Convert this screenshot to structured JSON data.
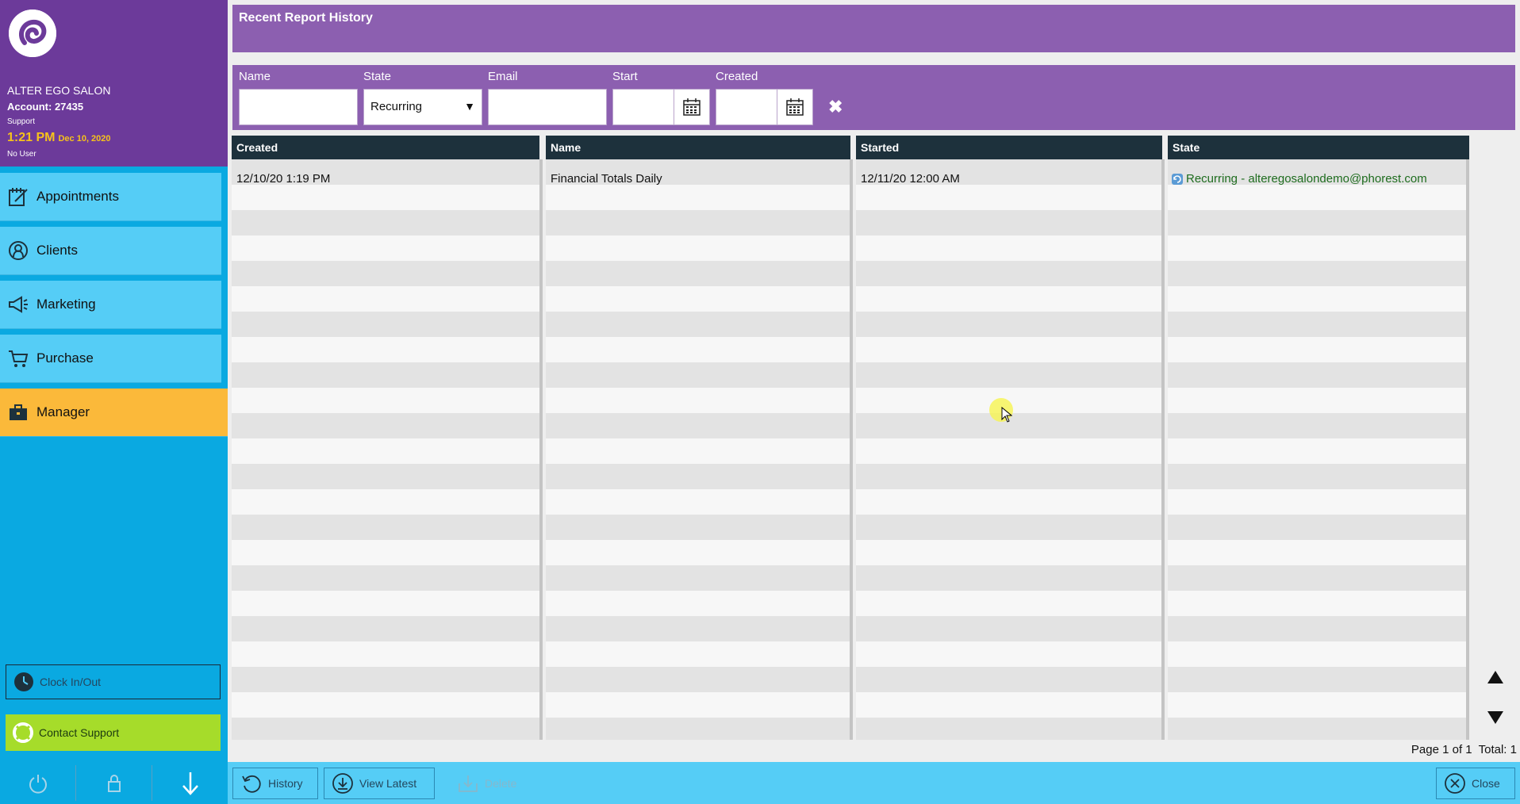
{
  "sidebar": {
    "salon_name": "ALTER EGO SALON",
    "account": "Account: 27435",
    "role": "Support",
    "time": "1:21 PM",
    "date": "Dec 10, 2020",
    "user": "No User",
    "nav": [
      {
        "label": "Appointments",
        "icon": "appointments-icon"
      },
      {
        "label": "Clients",
        "icon": "clients-icon"
      },
      {
        "label": "Marketing",
        "icon": "megaphone-icon"
      },
      {
        "label": "Purchase",
        "icon": "cart-icon"
      },
      {
        "label": "Manager",
        "icon": "briefcase-icon",
        "active": true
      }
    ],
    "clock_in_out": "Clock In/Out",
    "contact_support": "Contact Support"
  },
  "page": {
    "title": "Recent Report History"
  },
  "filters": {
    "name_label": "Name",
    "state_label": "State",
    "state_value": "Recurring",
    "email_label": "Email",
    "start_label": "Start",
    "created_label": "Created",
    "clear": "✖"
  },
  "table": {
    "columns": [
      "Created",
      "Name",
      "Started",
      "State"
    ],
    "rows": [
      {
        "created": "12/10/20 1:19 PM",
        "name": "Financial Totals Daily",
        "started": "12/11/20 12:00 AM",
        "state": "Recurring - alteregosalondemo@phorest.com"
      }
    ]
  },
  "paging": {
    "page": "Page 1 of 1",
    "total": "Total: 1"
  },
  "toolbar": {
    "history": "History",
    "view_latest": "View Latest",
    "delete": "Delete",
    "close": "Close"
  },
  "colors": {
    "header_purple": "#6c3a9a",
    "bar_purple": "#8c5fb0",
    "sidebar_blue": "#0aa9e1",
    "nav_blue": "#55cdf6",
    "active_orange": "#fbb93a",
    "support_green": "#a6dc2a"
  }
}
